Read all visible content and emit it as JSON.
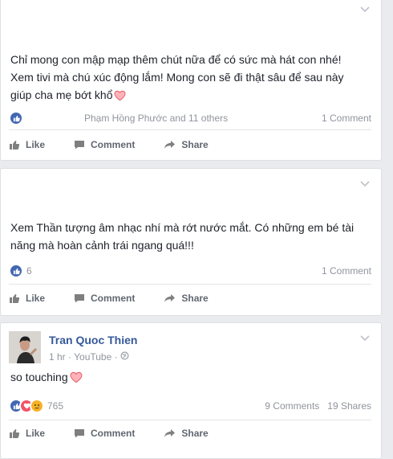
{
  "posts": [
    {
      "text_lines": [
        "Chỉ mong con mập mạp thêm chút nữa để có sức mà hát con nhé!",
        "Xem tivi mà chú xúc động lắm! Mong con sẽ đi thật sâu để sau này",
        "giúp cha mẹ bớt khổ"
      ],
      "reactions_summary": "Phạm Hồng Phước and 11 others",
      "comments": "1 Comment",
      "reaction_icons": [
        "like-icon"
      ]
    },
    {
      "text_lines": [
        "Xem Thần tượng âm nhạc nhí mà rớt nước mắt. Có những em bé tài",
        "năng mà hoàn cảnh trái ngang quá!!!"
      ],
      "reaction_count": "6",
      "comments": "1 Comment",
      "reaction_icons": [
        "like-icon"
      ]
    },
    {
      "author": "Tran Quoc Thien",
      "meta": "1 hr · YouTube ·",
      "text": "so touching",
      "reaction_count": "765",
      "comments": "9 Comments",
      "shares": "19 Shares",
      "reaction_icons": [
        "like-icon",
        "love-icon",
        "sad-icon"
      ]
    }
  ],
  "actions": {
    "like": "Like",
    "comment": "Comment",
    "share": "Share"
  },
  "colors": {
    "link": "#365899",
    "like": "#4267b2",
    "love": "#f25268",
    "sad": "#f7b125",
    "muted": "#90949c"
  }
}
